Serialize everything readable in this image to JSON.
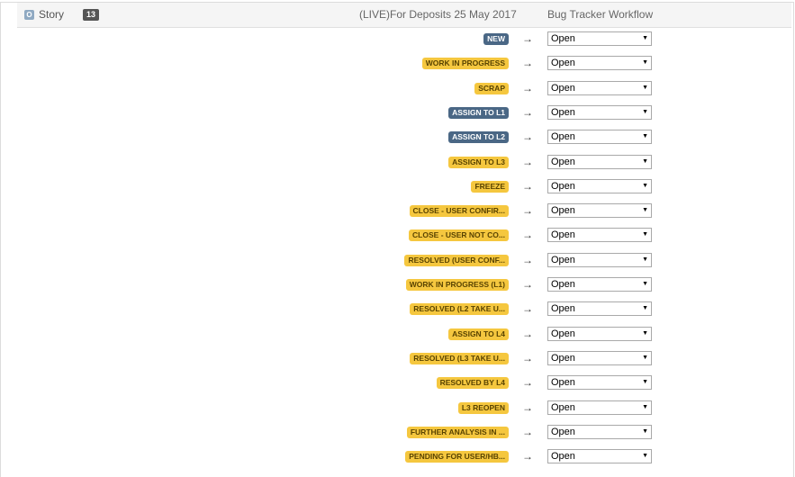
{
  "header": {
    "type_icon": "O",
    "type_label": "Story",
    "count": "13",
    "project": "(LIVE)For Deposits 25 May 2017",
    "workflow": "Bug Tracker Workflow"
  },
  "colors": {
    "yellow_badge": "#f5c73f",
    "blue_badge": "#4a6785"
  },
  "arrow_glyph": "→",
  "caret_glyph": "▼",
  "mappings": [
    {
      "status": "NEW",
      "color": "blue",
      "target": "Open"
    },
    {
      "status": "WORK IN PROGRESS",
      "color": "yellow",
      "target": "Open"
    },
    {
      "status": "SCRAP",
      "color": "yellow",
      "target": "Open"
    },
    {
      "status": "ASSIGN TO L1",
      "color": "blue",
      "target": "Open"
    },
    {
      "status": "ASSIGN TO L2",
      "color": "blue",
      "target": "Open"
    },
    {
      "status": "ASSIGN TO L3",
      "color": "yellow",
      "target": "Open"
    },
    {
      "status": "FREEZE",
      "color": "yellow",
      "target": "Open"
    },
    {
      "status": "CLOSE - USER CONFIR...",
      "color": "yellow",
      "target": "Open"
    },
    {
      "status": "CLOSE - USER NOT CO...",
      "color": "yellow",
      "target": "Open"
    },
    {
      "status": "RESOLVED (USER CONF...",
      "color": "yellow",
      "target": "Open"
    },
    {
      "status": "WORK IN PROGRESS (L1)",
      "color": "yellow",
      "target": "Open"
    },
    {
      "status": "RESOLVED (L2 TAKE U...",
      "color": "yellow",
      "target": "Open"
    },
    {
      "status": "ASSIGN TO L4",
      "color": "yellow",
      "target": "Open"
    },
    {
      "status": "RESOLVED (L3 TAKE U...",
      "color": "yellow",
      "target": "Open"
    },
    {
      "status": "RESOLVED BY L4",
      "color": "yellow",
      "target": "Open"
    },
    {
      "status": "L3 REOPEN",
      "color": "yellow",
      "target": "Open"
    },
    {
      "status": "FURTHER ANALYSIS IN ...",
      "color": "yellow",
      "target": "Open"
    },
    {
      "status": "PENDING FOR USER/HB...",
      "color": "yellow",
      "target": "Open"
    }
  ]
}
